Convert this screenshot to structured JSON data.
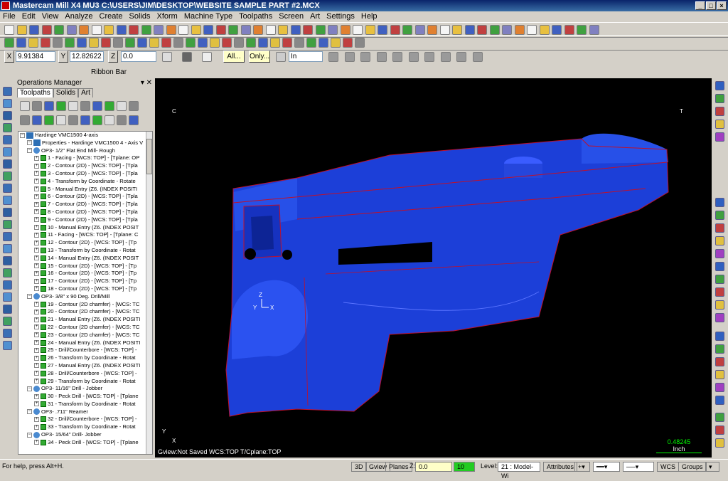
{
  "window": {
    "title": "Mastercam Mill X4 MU3  C:\\USERS\\JIM\\DESKTOP\\WEBSITE SAMPLE PART #2.MCX"
  },
  "menu": [
    "File",
    "Edit",
    "View",
    "Analyze",
    "Create",
    "Solids",
    "Xform",
    "Machine Type",
    "Toolpaths",
    "Screen",
    "Art",
    "Settings",
    "Help"
  ],
  "ribbon": {
    "x": "9.91384",
    "y": "12.82622",
    "z": "0.0",
    "all": "All...",
    "only": "Only...",
    "units": "In",
    "label": "Ribbon Bar"
  },
  "ops": {
    "title": "Operations Manager",
    "tabs": [
      "Toolpaths",
      "Solids",
      "Art"
    ],
    "rows": [
      {
        "t": "m",
        "d": 0,
        "txt": "Hardinge VMC1500 4-axis"
      },
      {
        "t": "p",
        "d": 1,
        "txt": "Properties - Hardinge VMC1500 4 - Axis V"
      },
      {
        "t": "o",
        "d": 1,
        "txt": "OP3- 1/2\" Flat End Mill- Rough"
      },
      {
        "t": "c",
        "d": 2,
        "txt": "1 - Facing - [WCS: TOP] - [Tplane: OP"
      },
      {
        "t": "c",
        "d": 2,
        "txt": "2 - Contour (2D) - [WCS: TOP] - [Tpla"
      },
      {
        "t": "c",
        "d": 2,
        "txt": "3 - Contour (2D) - [WCS: TOP] - [Tpla"
      },
      {
        "t": "c",
        "d": 2,
        "txt": "4 - Transform by Coordinate - Rotate"
      },
      {
        "t": "c",
        "d": 2,
        "txt": "5 - Manual Entry (Z6. (INDEX POSITI"
      },
      {
        "t": "c",
        "d": 2,
        "txt": "6 - Contour (2D) - [WCS: TOP] - [Tpla"
      },
      {
        "t": "c",
        "d": 2,
        "txt": "7 - Contour (2D) - [WCS: TOP] - [Tpla"
      },
      {
        "t": "c",
        "d": 2,
        "txt": "8 - Contour (2D) - [WCS: TOP] - [Tpla"
      },
      {
        "t": "c",
        "d": 2,
        "txt": "9 - Contour (2D) - [WCS: TOP] - [Tpla"
      },
      {
        "t": "c",
        "d": 2,
        "txt": "10 - Manual Entry (Z6. (INDEX POSIT"
      },
      {
        "t": "c",
        "d": 2,
        "txt": "11 - Facing - [WCS: TOP] - [Tplane: C"
      },
      {
        "t": "c",
        "d": 2,
        "txt": "12 - Contour (2D) - [WCS: TOP] - [Tp"
      },
      {
        "t": "c",
        "d": 2,
        "txt": "13 - Transform by Coordinate - Rotat"
      },
      {
        "t": "c",
        "d": 2,
        "txt": "14 - Manual Entry (Z6. (INDEX POSIT"
      },
      {
        "t": "c",
        "d": 2,
        "txt": "15 - Contour (2D) - [WCS: TOP] - [Tp"
      },
      {
        "t": "c",
        "d": 2,
        "txt": "16 - Contour (2D) - [WCS: TOP] - [Tp"
      },
      {
        "t": "c",
        "d": 2,
        "txt": "17 - Contour (2D) - [WCS: TOP] - [Tp"
      },
      {
        "t": "c",
        "d": 2,
        "txt": "18 - Contour (2D) - [WCS: TOP] - [Tp"
      },
      {
        "t": "o",
        "d": 1,
        "txt": "OP3- 3/8\" x 90 Deg. Drill/Mill"
      },
      {
        "t": "c",
        "d": 2,
        "txt": "19 - Contour (2D chamfer) - [WCS: TC"
      },
      {
        "t": "c",
        "d": 2,
        "txt": "20 - Contour (2D chamfer) - [WCS: TC"
      },
      {
        "t": "c",
        "d": 2,
        "txt": "21 - Manual Entry (Z6. (INDEX POSITI"
      },
      {
        "t": "c",
        "d": 2,
        "txt": "22 - Contour (2D chamfer) - [WCS: TC"
      },
      {
        "t": "c",
        "d": 2,
        "txt": "23 - Contour (2D chamfer) - [WCS: TC"
      },
      {
        "t": "c",
        "d": 2,
        "txt": "24 - Manual Entry (Z6. (INDEX POSITI"
      },
      {
        "t": "c",
        "d": 2,
        "txt": "25 - Drill/Counterbore - [WCS: TOP] -"
      },
      {
        "t": "c",
        "d": 2,
        "txt": "26 - Transform by Coordinate - Rotat"
      },
      {
        "t": "c",
        "d": 2,
        "txt": "27 - Manual Entry (Z6. (INDEX POSITI"
      },
      {
        "t": "c",
        "d": 2,
        "txt": "28 - Drill/Counterbore - [WCS: TOP] -"
      },
      {
        "t": "c",
        "d": 2,
        "txt": "29 - Transform by Coordinate - Rotat"
      },
      {
        "t": "o",
        "d": 1,
        "txt": "OP3- 11/16\" Drill - Jobber"
      },
      {
        "t": "c",
        "d": 2,
        "txt": "30 - Peck Drill - [WCS: TOP] - [Tplane"
      },
      {
        "t": "c",
        "d": 2,
        "txt": "31 - Transform by Coordinate - Rotat"
      },
      {
        "t": "o",
        "d": 1,
        "txt": "OP3- .711\" Reamer"
      },
      {
        "t": "c",
        "d": 2,
        "txt": "32 - Drill/Counterbore - [WCS: TOP] -"
      },
      {
        "t": "c",
        "d": 2,
        "txt": "33 - Transform by Coordinate - Rotat"
      },
      {
        "t": "o",
        "d": 1,
        "txt": "OP3- 15/64\" Drill- Jobber"
      },
      {
        "t": "c",
        "d": 2,
        "txt": "34 - Peck Drill - [WCS: TOP] - [Tplane"
      }
    ]
  },
  "viewport": {
    "status": "Gview:Not Saved   WCS:TOP   T/Cplane:TOP",
    "scale": "0.48245",
    "scale_unit": "Inch",
    "axis_tl": "C",
    "axis_tr": "T",
    "axis_x": "X",
    "axis_y": "Y",
    "axis_z": "Z",
    "part_color": "#1c3fd8",
    "edge_color": "#c0102a"
  },
  "status": {
    "help": "For help, press Alt+H.",
    "b3d": "3D",
    "gview": "Gview",
    "planes": "Planes",
    "z": "Z:",
    "zval": "0.0",
    "level_val": "10",
    "level": "Level:",
    "level_sel": "21 : Model- Wi",
    "attr": "Attributes",
    "wcs": "WCS",
    "groups": "Groups"
  }
}
